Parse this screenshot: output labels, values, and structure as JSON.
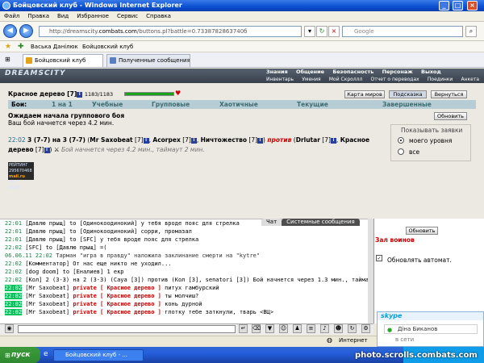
{
  "window": {
    "title": "Бойцовский клуб - Windows Internet Explorer"
  },
  "menu": [
    "Файл",
    "Правка",
    "Вид",
    "Избранное",
    "Сервис",
    "Справка"
  ],
  "address": {
    "prefix": "http://dreamscity.",
    "domain": "combats.com",
    "path": "/buttons.pl?battle=0.7338782863740б"
  },
  "search": {
    "placeholder": "Google"
  },
  "favorites": {
    "items": [
      "Васька Данілюк",
      "Бойцовский клуб"
    ]
  },
  "tabs": [
    {
      "label": "Бойцовский клуб"
    },
    {
      "label": "Полученные сообщения | 1..."
    }
  ],
  "game": {
    "logo": "DREAMSCITY",
    "nav_top": [
      "Знания",
      "Общение",
      "Безопасность",
      "Персонаж",
      "Выход"
    ],
    "nav_bottom": [
      "Инвентарь",
      "Умения",
      "Мой Скроллл",
      "Отчет о переводах",
      "Поединки",
      "Анкета"
    ],
    "player": {
      "name": "Красное дерево",
      "level": "[7]",
      "hp": "1183/1183",
      "hp_fraction": 1.0
    },
    "buttons": {
      "map": "Карта миров",
      "hint": "Подсказка",
      "back": "Вернуться",
      "refresh": "Обновить"
    },
    "battle_tabs": {
      "label": "Бои:",
      "items": [
        "1 на 1",
        "Учебные",
        "Групповые",
        "Хаотичные",
        "Текущие",
        "Завершенные"
      ]
    },
    "waiting_title": "Ожидаем начала группового боя",
    "waiting_text": "Ваш бой начнется через 4.2 мин.",
    "fight": {
      "time": "22:02",
      "team_sizes": "3 (7-7) на 3 (7-7)",
      "p1": "Mr Saxobeat",
      "p1_level": "[7]",
      "p2": "Acorpex",
      "p2_level": "[7]",
      "p3": "Ничтожество",
      "p3_level": "[7]",
      "vs": "против",
      "p4": "Drlutar",
      "p4_level": "[7]",
      "p5": "Красное дерево",
      "p5_level": "[7]",
      "note": "Бой начнется через 4.2 мин., таймаут 2 мин."
    },
    "show": {
      "title": "Показывать заявки",
      "opt1": "моего уровня",
      "opt2": "все"
    },
    "counter": {
      "line1": "РЕЙТИНГ 295670468",
      "line2": "mail.ru",
      "line3": "89",
      "line4": "26781"
    }
  },
  "chat": {
    "tabs": [
      "Чат",
      "Системные сообщения"
    ],
    "lines": [
      {
        "t": "22:01",
        "text": "[Давлю прыщ] to [Одинокоодинокий] у тебя вроде пояс для стрелка"
      },
      {
        "t": "22:01",
        "text": "[Давлю прыщ] to [Одинокоодинокий] сорри, промазал"
      },
      {
        "t": "22:01",
        "text": "[Давлю прыщ] to [SFC] у тебя вроде пояс для стрелка"
      },
      {
        "t": "22:02",
        "text": "[SFC] to [Давлю прыщ] =("
      },
      {
        "t": "06.06.11 22:02",
        "text": "Тарман \"игра в правду\" наложила заклинание смерти на \"kytre\""
      },
      {
        "t": "22:02",
        "text": "[Комментатор] От нас еще никто не уходил..."
      },
      {
        "t": "22:02",
        "text": "[dog doom] to [Еналиев] 1 екр"
      },
      {
        "t": "22:02",
        "text": "[Кол] 2 (3-3) на 2 (3-3) (Саya [3]) против (Кол [3], senatori [3]) Бой начнется через 1.3 мин., таймаут 1 мин."
      },
      {
        "t": "22:02",
        "who": "[Mr Saxobeat]",
        "priv": "private [ Красное дерево ]",
        "msg": "питух гамбурский"
      },
      {
        "t": "22:02",
        "who": "[Mr Saxobeat]",
        "priv": "private [ Красное дерево ]",
        "msg": "ты молчиш?"
      },
      {
        "t": "22:02",
        "who": "[Mr Saxobeat]",
        "priv": "private [ Красное дерево ]",
        "msg": "конь дурной"
      },
      {
        "t": "22:02",
        "who": "[Mr Saxobeat]",
        "priv": "private [ Красное дерево ]",
        "msg": "глотку тебе заткнули, тварь <ВЦ>"
      }
    ]
  },
  "side": {
    "refresh": "Обновить",
    "hall": "Зал воинов",
    "auto": "Обновлять автомат."
  },
  "status": {
    "zone": "Интернет"
  },
  "taskbar": {
    "start": "пуск",
    "item": "Бойцовский клуб - ..."
  },
  "skype": {
    "title": "skype",
    "name": "Діна Биканов",
    "state": "в сети"
  },
  "watermark": "photo.scrolls.combats.com"
}
